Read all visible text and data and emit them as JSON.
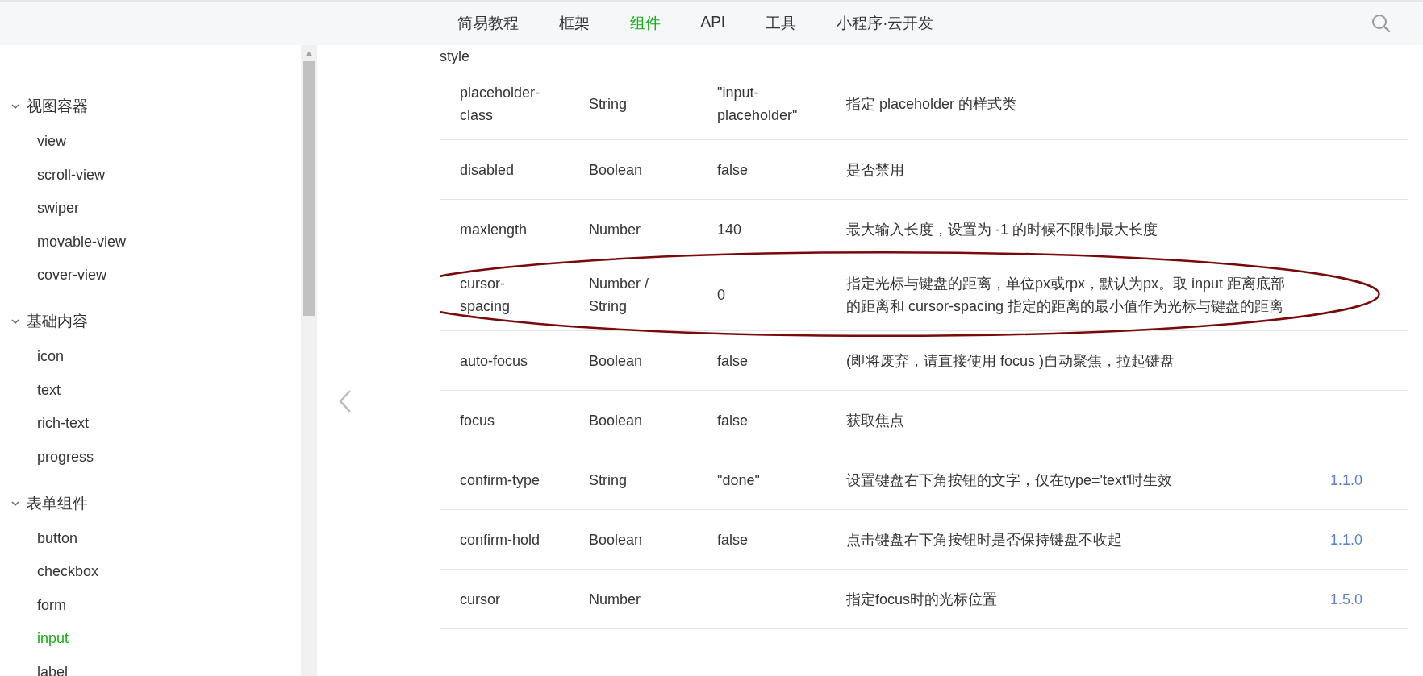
{
  "nav": {
    "items": [
      {
        "label": "简易教程",
        "selected": false
      },
      {
        "label": "框架",
        "selected": false
      },
      {
        "label": "组件",
        "selected": true
      },
      {
        "label": "API",
        "selected": false
      },
      {
        "label": "工具",
        "selected": false
      },
      {
        "label": "小程序·云开发",
        "selected": false
      }
    ]
  },
  "sidebar": {
    "groups": [
      {
        "label": "视图容器",
        "expanded": true,
        "children": [
          {
            "label": "view",
            "selected": false
          },
          {
            "label": "scroll-view",
            "selected": false
          },
          {
            "label": "swiper",
            "selected": false
          },
          {
            "label": "movable-view",
            "selected": false
          },
          {
            "label": "cover-view",
            "selected": false
          }
        ]
      },
      {
        "label": "基础内容",
        "expanded": true,
        "children": [
          {
            "label": "icon",
            "selected": false
          },
          {
            "label": "text",
            "selected": false
          },
          {
            "label": "rich-text",
            "selected": false
          },
          {
            "label": "progress",
            "selected": false
          }
        ]
      },
      {
        "label": "表单组件",
        "expanded": true,
        "children": [
          {
            "label": "button",
            "selected": false
          },
          {
            "label": "checkbox",
            "selected": false
          },
          {
            "label": "form",
            "selected": false
          },
          {
            "label": "input",
            "selected": true
          },
          {
            "label": "label",
            "selected": false
          }
        ]
      }
    ]
  },
  "table": {
    "rows": [
      {
        "name": "style",
        "circled": false
      },
      {
        "name": "placeholder-class",
        "type": "String",
        "default": "\"input-placeholder\"",
        "description": "指定 placeholder 的样式类",
        "circled": false
      },
      {
        "name": "disabled",
        "type": "Boolean",
        "default": "false",
        "description": "是否禁用",
        "circled": false
      },
      {
        "name": "maxlength",
        "type": "Number",
        "default": "140",
        "description": "最大输入长度，设置为 -1 的时候不限制最大长度",
        "circled": false
      },
      {
        "name": "cursor-spacing",
        "type": "Number / String",
        "default": "0",
        "description": "指定光标与键盘的距离，单位px或rpx，默认为px。取 input 距离底部的距离和 cursor-spacing 指定的距离的最小值作为光标与键盘的距离",
        "circled": true
      },
      {
        "name": "auto-focus",
        "type": "Boolean",
        "default": "false",
        "description": "(即将废弃，请直接使用 focus )自动聚焦，拉起键盘",
        "circled": false
      },
      {
        "name": "focus",
        "type": "Boolean",
        "default": "false",
        "description": "获取焦点",
        "circled": false
      },
      {
        "name": "confirm-type",
        "type": "String",
        "default": "\"done\"",
        "description": "设置键盘右下角按钮的文字，仅在type='text'时生效",
        "version": "1.1.0",
        "circled": false
      },
      {
        "name": "confirm-hold",
        "type": "Boolean",
        "default": "false",
        "description": "点击键盘右下角按钮时是否保持键盘不收起",
        "version": "1.1.0",
        "circled": false
      },
      {
        "name": "cursor",
        "type": "Number",
        "description": "指定focus时的光标位置",
        "version": "1.5.0",
        "circled": false
      }
    ]
  }
}
